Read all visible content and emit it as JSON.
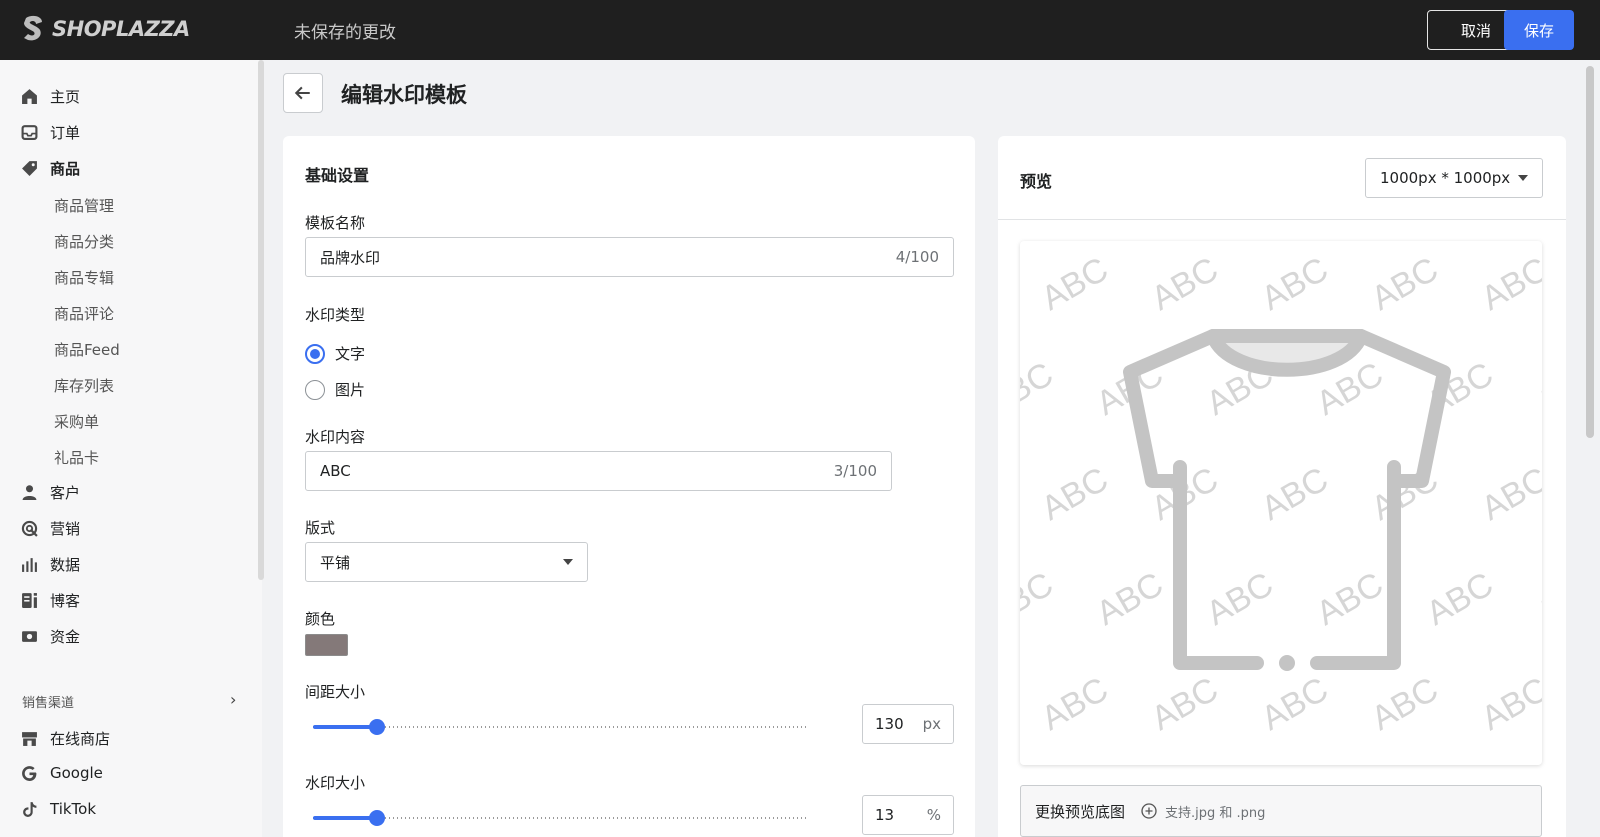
{
  "topbar": {
    "logo_text": "SHOPLAZZA",
    "status": "未保存的更改",
    "cancel_label": "取消",
    "save_label": "保存"
  },
  "sidebar": {
    "items": [
      {
        "label": "主页",
        "icon": "home-icon"
      },
      {
        "label": "订单",
        "icon": "inbox-icon"
      },
      {
        "label": "商品",
        "icon": "tag-icon",
        "active": true
      },
      {
        "label": "客户",
        "icon": "person-icon"
      },
      {
        "label": "营销",
        "icon": "target-icon"
      },
      {
        "label": "数据",
        "icon": "bar-chart-icon"
      },
      {
        "label": "博客",
        "icon": "blog-icon"
      },
      {
        "label": "资金",
        "icon": "money-icon"
      }
    ],
    "sub_items": [
      "商品管理",
      "商品分类",
      "商品专辑",
      "商品评论",
      "商品Feed",
      "库存列表",
      "采购单",
      "礼品卡"
    ],
    "section_label": "销售渠道",
    "channels": [
      {
        "label": "在线商店",
        "icon": "store-icon"
      },
      {
        "label": "Google",
        "icon": "google-icon"
      },
      {
        "label": "TikTok",
        "icon": "tiktok-icon"
      }
    ]
  },
  "page": {
    "title": "编辑水印模板"
  },
  "form": {
    "section_title": "基础设置",
    "name_label": "模板名称",
    "name_value": "品牌水印",
    "name_counter": "4/100",
    "type_label": "水印类型",
    "type_options": [
      "文字",
      "图片"
    ],
    "type_selected": "文字",
    "content_label": "水印内容",
    "content_value": "ABC",
    "content_counter": "3/100",
    "layout_label": "版式",
    "layout_value": "平铺",
    "color_label": "颜色",
    "color_value": "#847979",
    "spacing_label": "间距大小",
    "spacing_value": "130",
    "spacing_unit": "px",
    "spacing_fraction": 0.13,
    "size_label": "水印大小",
    "size_value": "13",
    "size_unit": "%",
    "size_fraction": 0.13
  },
  "preview": {
    "title": "预览",
    "size_option": "1000px * 1000px",
    "watermark_text": "ABC",
    "replace_label": "更换预览底图",
    "replace_hint": "支持.jpg 和 .png"
  }
}
